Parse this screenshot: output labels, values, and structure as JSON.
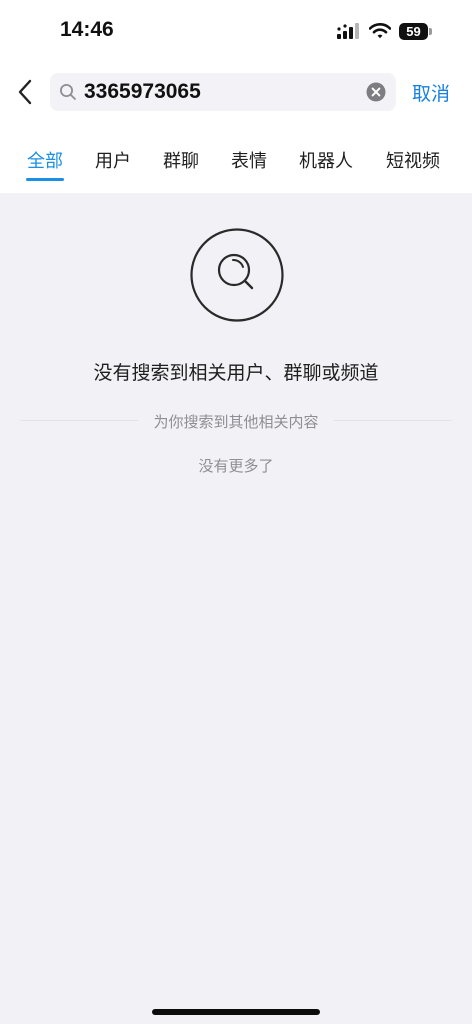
{
  "status_bar": {
    "time": "14:46",
    "battery_level": "59",
    "icons": [
      "signal-icon",
      "wifi-icon",
      "battery-icon"
    ]
  },
  "search": {
    "query": "3365973065",
    "cancel_label": "取消"
  },
  "tabs": [
    {
      "label": "全部",
      "active": true
    },
    {
      "label": "用户",
      "active": false
    },
    {
      "label": "群聊",
      "active": false
    },
    {
      "label": "表情",
      "active": false
    },
    {
      "label": "机器人",
      "active": false
    },
    {
      "label": "短视频",
      "active": false
    }
  ],
  "empty_state": {
    "icon": "search-empty-icon",
    "title": "没有搜索到相关用户、群聊或频道",
    "suggest_label": "为你搜索到其他相关内容",
    "no_more": "没有更多了"
  },
  "colors": {
    "accent": "#1a8fe6",
    "background": "#f1f1f6",
    "secondary_text": "#8e8e93"
  }
}
